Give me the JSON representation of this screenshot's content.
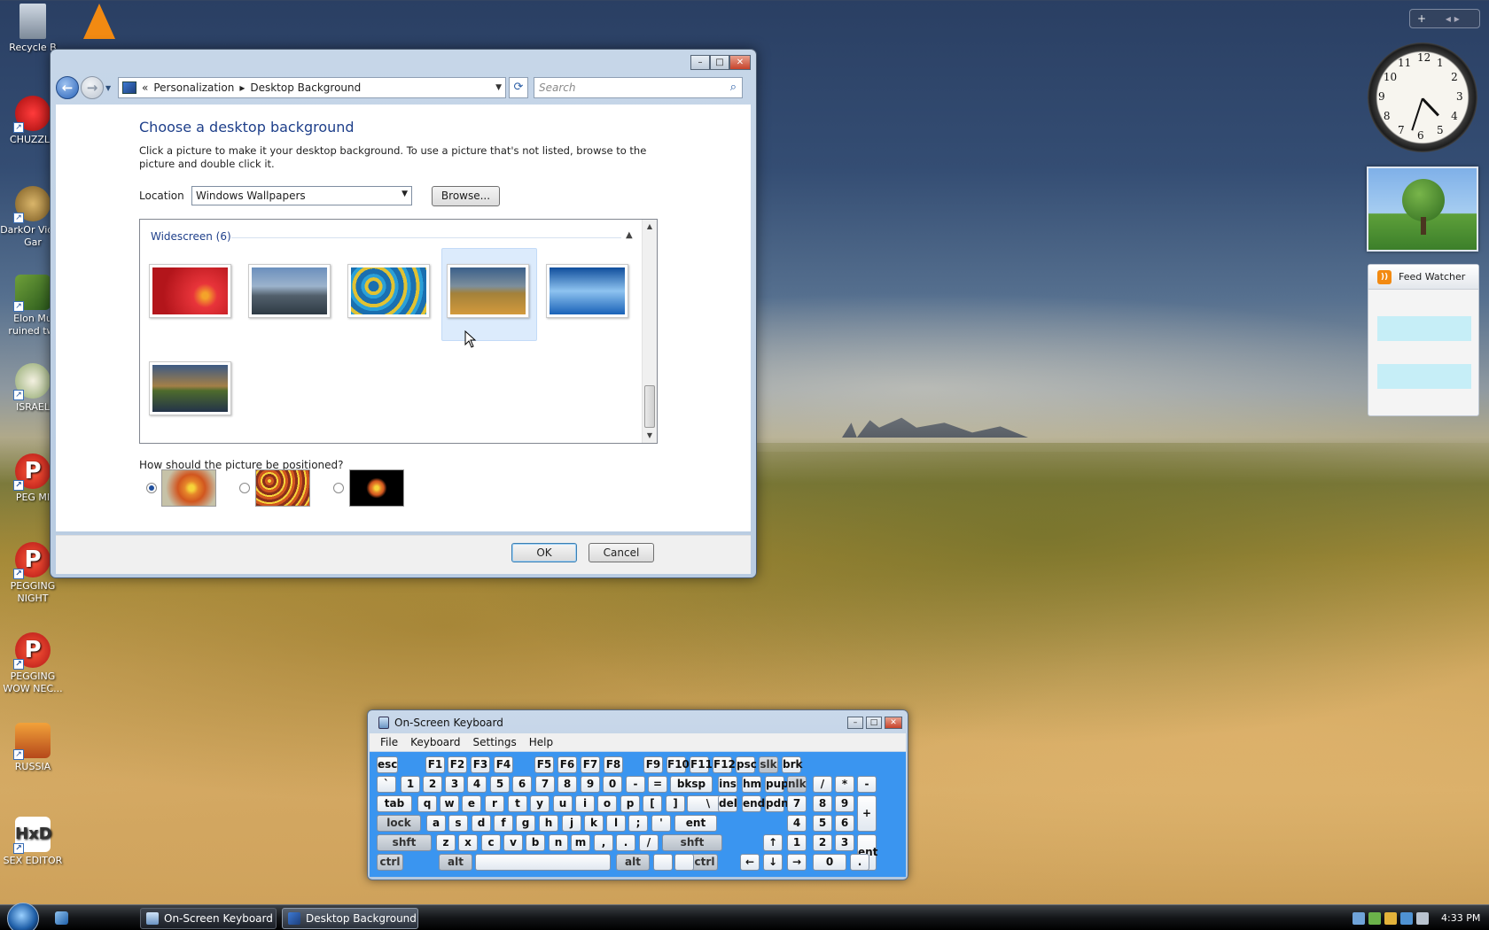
{
  "desktop": {
    "icons": [
      {
        "label": "Recycle B"
      },
      {
        "label": "CHUZZLE"
      },
      {
        "label": "DarkOr Video Gar"
      },
      {
        "label": "Elon Mu ruined twi"
      },
      {
        "label": "ISRAEL"
      },
      {
        "label": "PEG MI"
      },
      {
        "label": "PEGGING NIGHT"
      },
      {
        "label": "PEGGING WOW NEC..."
      },
      {
        "label": "RUSSIA"
      },
      {
        "label": "SEX EDITOR"
      }
    ]
  },
  "window": {
    "breadcrumb": {
      "root_chevron": "«",
      "crumbs": [
        "Personalization",
        "Desktop Background"
      ]
    },
    "search": {
      "placeholder": "Search"
    },
    "heading": "Choose a desktop background",
    "description": "Click a picture to make it your desktop background. To use a picture that's not listed, browse to the picture and double click it.",
    "location_label": "Location",
    "location_value": "Windows Wallpapers",
    "browse_label": "Browse...",
    "group_title": "Widescreen (6)",
    "thumbnails": [
      {
        "name": "red-flower",
        "colors": [
          "#b3151b",
          "#e8343a"
        ]
      },
      {
        "name": "mountain-cliff",
        "colors": [
          "#5e7fa8",
          "#2e3a44"
        ]
      },
      {
        "name": "blue-yellow-fish",
        "colors": [
          "#1a6fb0",
          "#e1c232"
        ]
      },
      {
        "name": "dunes",
        "colors": [
          "#3a5f8a",
          "#d39a3c"
        ],
        "selected": true
      },
      {
        "name": "ocean-blue",
        "colors": [
          "#1a62b8",
          "#8ec3f0"
        ]
      },
      {
        "name": "mountain-lake",
        "colors": [
          "#3d5a84",
          "#4e6b2c"
        ]
      }
    ],
    "position_question": "How should the picture be positioned?",
    "position_options": [
      {
        "name": "fit",
        "selected": true
      },
      {
        "name": "tile",
        "selected": false
      },
      {
        "name": "center",
        "selected": false
      }
    ],
    "ok_label": "OK",
    "cancel_label": "Cancel"
  },
  "gadgets": {
    "toolbar": "+",
    "clock": {
      "hour": 4,
      "minute": 33,
      "numbers": [
        "12",
        "1",
        "2",
        "3",
        "4",
        "5",
        "6",
        "7",
        "8",
        "9",
        "10",
        "11"
      ]
    },
    "feed_watcher_title": "Feed Watcher"
  },
  "osk": {
    "title": "On-Screen Keyboard",
    "menu": [
      "File",
      "Keyboard",
      "Settings",
      "Help"
    ],
    "keys": {
      "row1": [
        "esc",
        "F1",
        "F2",
        "F3",
        "F4",
        "F5",
        "F6",
        "F7",
        "F8",
        "F9",
        "F10",
        "F11",
        "F12",
        "psc",
        "slk",
        "brk"
      ],
      "row2": [
        "`",
        "1",
        "2",
        "3",
        "4",
        "5",
        "6",
        "7",
        "8",
        "9",
        "0",
        "-",
        "=",
        "bksp",
        "ins",
        "hm",
        "pup",
        "nlk",
        "/",
        "*",
        "-"
      ],
      "row3": [
        "tab",
        "q",
        "w",
        "e",
        "r",
        "t",
        "y",
        "u",
        "i",
        "o",
        "p",
        "[",
        "]",
        "\\",
        "del",
        "end",
        "pdn",
        "7",
        "8",
        "9",
        "+"
      ],
      "row4": [
        "lock",
        "a",
        "s",
        "d",
        "f",
        "g",
        "h",
        "j",
        "k",
        "l",
        ";",
        "'",
        "ent",
        "4",
        "5",
        "6"
      ],
      "row5": [
        "shft",
        "z",
        "x",
        "c",
        "v",
        "b",
        "n",
        "m",
        ",",
        ".",
        "/",
        "shft",
        "↑",
        "1",
        "2",
        "3",
        "ent"
      ],
      "row6": [
        "ctrl",
        "alt",
        "alt",
        "ctrl",
        "←",
        "↓",
        "→",
        "0",
        "."
      ]
    }
  },
  "taskbar": {
    "buttons": [
      {
        "label": "On-Screen Keyboard",
        "active": false
      },
      {
        "label": "Desktop Background",
        "active": true
      }
    ],
    "time": "4:33 PM"
  }
}
